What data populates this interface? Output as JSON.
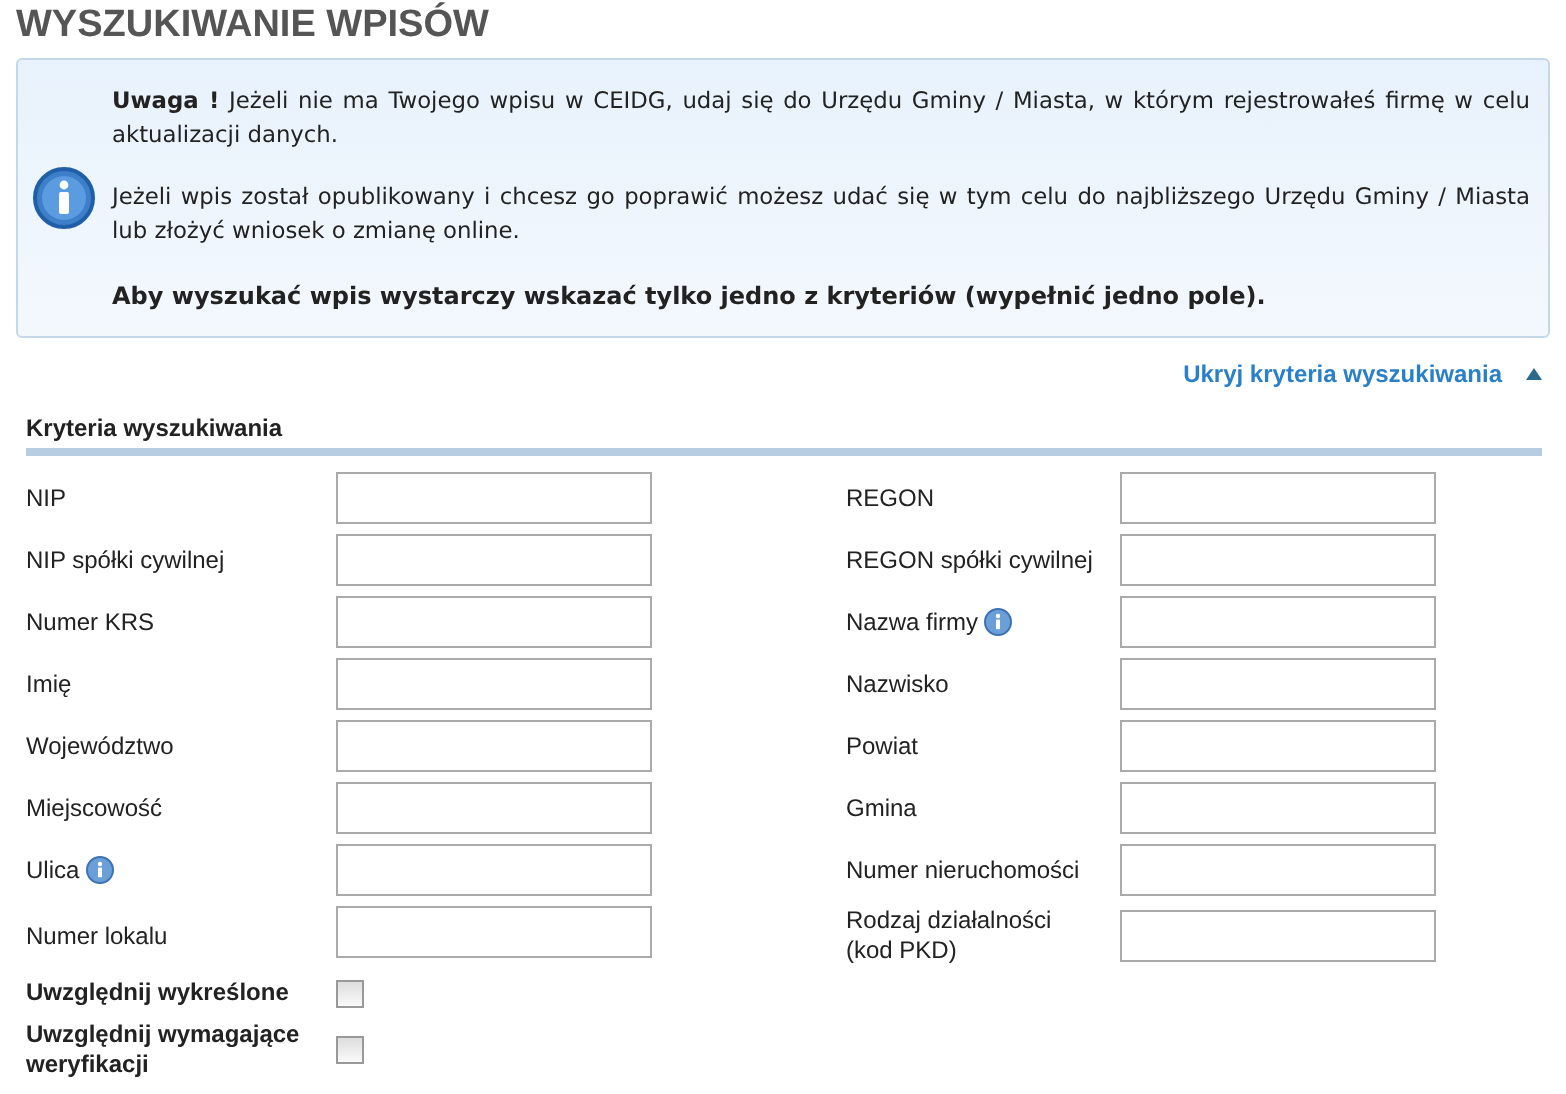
{
  "title": "WYSZUKIWANIE WPISÓW",
  "notice": {
    "paragraphs": [
      "**Uwaga !** Jeżeli nie ma Twojego wpisu w CEIDG, udaj się do Urzędu Gminy / Miasta, w którym rejestrowałeś firmę w celu aktualizacji danych.",
      "Jeżeli wpis został opublikowany i chcesz go poprawić możesz udać się w tym celu do najbliższego Urzędu Gminy / Miasta lub złożyć wniosek o zmianę online."
    ],
    "emphasis": "Aby wyszukać wpis wystarczy wskazać tylko jedno z kryteriów (wypełnić jedno pole)."
  },
  "toggle": {
    "label": "Ukryj kryteria wyszukiwania",
    "expanded": true
  },
  "section_title": "Kryteria wyszukiwania",
  "rows": [
    {
      "left": {
        "label": "NIP",
        "info": false
      },
      "right": {
        "label": "REGON",
        "info": false
      }
    },
    {
      "left": {
        "label": "NIP spółki cywilnej",
        "info": false
      },
      "right": {
        "label": "REGON spółki cywilnej",
        "info": false
      }
    },
    {
      "left": {
        "label": "Numer KRS",
        "info": false
      },
      "right": {
        "label": "Nazwa firmy",
        "info": true
      }
    },
    {
      "left": {
        "label": "Imię",
        "info": false
      },
      "right": {
        "label": "Nazwisko",
        "info": false
      }
    },
    {
      "left": {
        "label": "Województwo",
        "info": false
      },
      "right": {
        "label": "Powiat",
        "info": false
      }
    },
    {
      "left": {
        "label": "Miejscowość",
        "info": false
      },
      "right": {
        "label": "Gmina",
        "info": false
      }
    },
    {
      "left": {
        "label": "Ulica",
        "info": true
      },
      "right": {
        "label": "Numer nieruchomości",
        "info": false
      }
    },
    {
      "left": {
        "label": "Numer lokalu",
        "info": false
      },
      "right": {
        "label": "Rodzaj działalności (kod PKD)",
        "info": false
      }
    }
  ],
  "checkboxes": [
    {
      "label": "Uwzględnij wykreślone",
      "checked": false
    },
    {
      "label": "Uwzględnij wymagające weryfikacji",
      "checked": false
    }
  ]
}
